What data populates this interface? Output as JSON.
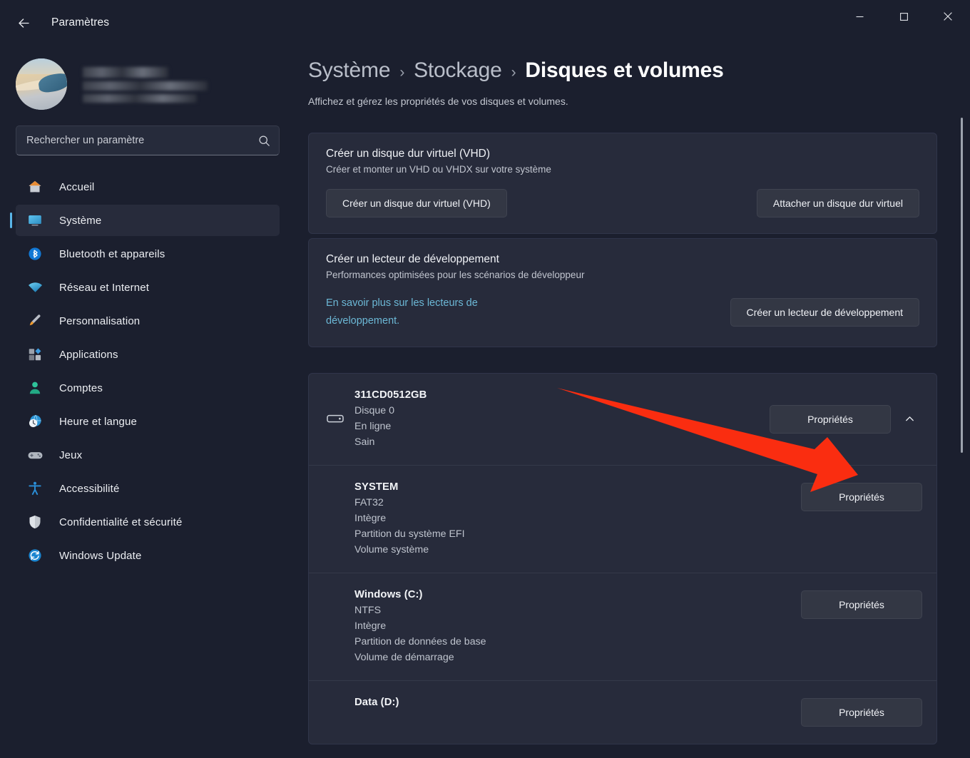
{
  "window": {
    "title": "Paramètres",
    "back_label": "Retour",
    "minimize_label": "Réduire",
    "maximize_label": "Agrandir",
    "close_label": "Fermer"
  },
  "sidebar": {
    "profile": {
      "name_redacted": true
    },
    "search": {
      "placeholder": "Rechercher un paramètre",
      "value": ""
    },
    "items": [
      {
        "label": "Accueil",
        "icon": "home-icon",
        "selected": false
      },
      {
        "label": "Système",
        "icon": "display-icon",
        "selected": true
      },
      {
        "label": "Bluetooth et appareils",
        "icon": "bluetooth-icon",
        "selected": false
      },
      {
        "label": "Réseau et Internet",
        "icon": "wifi-icon",
        "selected": false
      },
      {
        "label": "Personnalisation",
        "icon": "brush-icon",
        "selected": false
      },
      {
        "label": "Applications",
        "icon": "apps-icon",
        "selected": false
      },
      {
        "label": "Comptes",
        "icon": "person-icon",
        "selected": false
      },
      {
        "label": "Heure et langue",
        "icon": "clock-globe-icon",
        "selected": false
      },
      {
        "label": "Jeux",
        "icon": "gamepad-icon",
        "selected": false
      },
      {
        "label": "Accessibilité",
        "icon": "accessibility-icon",
        "selected": false
      },
      {
        "label": "Confidentialité et sécurité",
        "icon": "shield-icon",
        "selected": false
      },
      {
        "label": "Windows Update",
        "icon": "update-icon",
        "selected": false
      }
    ]
  },
  "main": {
    "breadcrumb": [
      {
        "label": "Système",
        "current": false
      },
      {
        "label": "Stockage",
        "current": false
      },
      {
        "label": "Disques et volumes",
        "current": true
      }
    ],
    "breadcrumb_separator": "›",
    "subtitle": "Affichez et gérez les propriétés de vos disques et volumes.",
    "cards": [
      {
        "title": "Créer un disque dur virtuel (VHD)",
        "description": "Créer et monter un VHD ou VHDX sur votre système",
        "primary_button": "Créer un disque dur virtuel (VHD)",
        "secondary_button": "Attacher un disque dur virtuel"
      },
      {
        "title": "Créer un lecteur de développement",
        "description": "Performances optimisées pour les scénarios de développeur",
        "link": "En savoir plus sur les lecteurs de développement.",
        "button": "Créer un lecteur de développement"
      }
    ],
    "disk": {
      "name": "311CD0512GB",
      "meta": [
        "Disque 0",
        "En ligne",
        "Sain"
      ],
      "properties_button": "Propriétés",
      "expander_icon": "chevron-up-icon",
      "volumes": [
        {
          "name": "SYSTEM",
          "meta": [
            "FAT32",
            "Intègre",
            "Partition du système EFI",
            "Volume système"
          ],
          "properties_button": "Propriétés"
        },
        {
          "name": "Windows (C:)",
          "meta": [
            "NTFS",
            "Intègre",
            "Partition de données de base",
            "Volume de démarrage"
          ],
          "properties_button": "Propriétés"
        },
        {
          "name": "Data (D:)",
          "meta": [],
          "properties_button": "Propriétés"
        }
      ]
    }
  },
  "annotation": {
    "type": "arrow",
    "color": "#FA2D10",
    "points_to": "disk-properties-button"
  },
  "colors": {
    "window_background": "#1B1F2E",
    "card_background": "#272B3B",
    "button_background": "#333744",
    "accent": "#5AB6E8",
    "link": "#6CB8D6",
    "annotation_red": "#FA2D10"
  }
}
